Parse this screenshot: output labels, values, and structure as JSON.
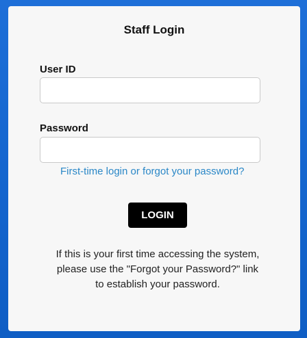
{
  "login": {
    "title": "Staff Login",
    "user_id_label": "User ID",
    "user_id_value": "",
    "password_label": "Password",
    "password_value": "",
    "forgot_link": "First-time login or forgot your password?",
    "login_button": "LOGIN",
    "info_lines": [
      "If this is your first time accessing the system,",
      "please use the \"Forgot your Password?\" link",
      "to establish your password."
    ]
  },
  "colors": {
    "frame_blue": "#1566cf",
    "card_background": "#f7f7f7",
    "link": "#2a87c7",
    "button": "#000000"
  }
}
